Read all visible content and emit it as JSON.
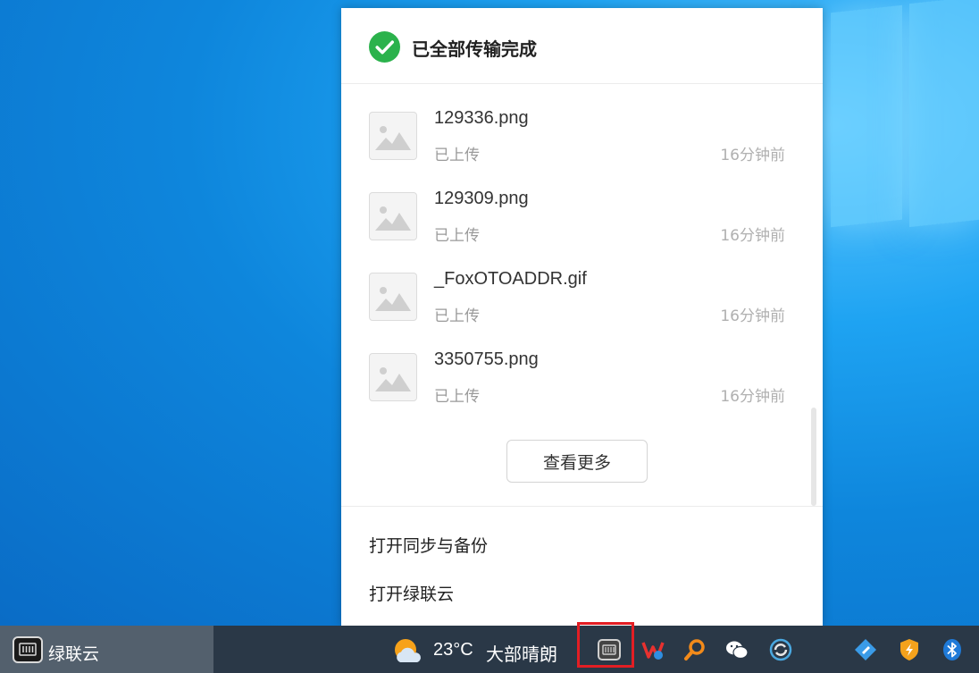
{
  "popup": {
    "header_title": "已全部传输完成",
    "files": [
      {
        "name": "129336.png",
        "status": "已上传",
        "time": "16分钟前"
      },
      {
        "name": "129309.png",
        "status": "已上传",
        "time": "16分钟前"
      },
      {
        "name": "_FoxOTOADDR.gif",
        "status": "已上传",
        "time": "16分钟前"
      },
      {
        "name": "3350755.png",
        "status": "已上传",
        "time": "16分钟前"
      }
    ],
    "more_button": "查看更多",
    "menu": {
      "open_sync": "打开同步与备份",
      "open_app": "打开绿联云"
    }
  },
  "taskbar": {
    "app_label": "绿联云",
    "weather": {
      "temp": "23°C",
      "desc": "大部晴朗"
    },
    "tray_icons": [
      "ugreen-nas-icon",
      "wps-icon",
      "search-tool-icon",
      "wechat-icon",
      "security-shield-icon",
      "tag-app-icon",
      "shield-app-icon",
      "bluetooth-icon"
    ]
  },
  "colors": {
    "accent_green": "#2bb24c",
    "highlight_red": "#e31e24",
    "taskbar_bg": "#2a3847"
  }
}
